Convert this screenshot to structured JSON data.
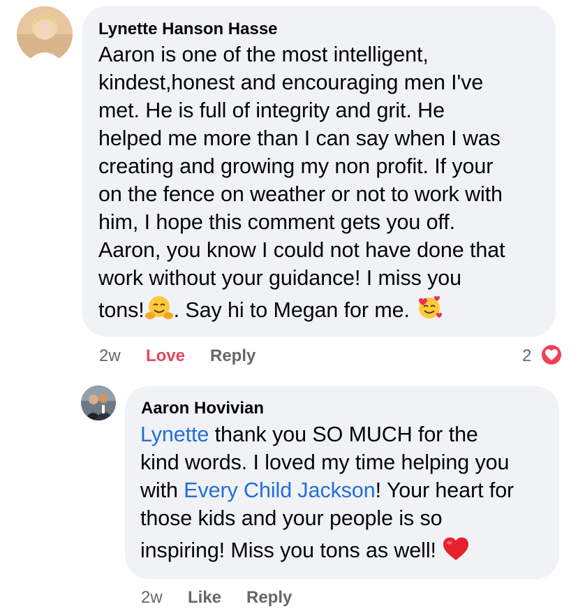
{
  "comment": {
    "author": "Lynette Hanson Hasse",
    "body_lines": [
      "Aaron is one of the most intelligent,",
      "kindest,honest and encouraging men I've",
      "met. He is full of integrity and grit. He",
      "helped me more than I can say when I was",
      "creating and growing my non profit. If your",
      "on the fence on weather or not to work with",
      "him, I hope this comment gets you off.",
      "Aaron, you know I could not have done that",
      "work without your guidance! I miss you"
    ],
    "last_line_a": "tons!",
    "last_line_b": ". Say hi to Megan for me.",
    "emoji_1": "hugging-face-emoji",
    "emoji_2": "smiling-face-with-hearts-emoji",
    "time": "2w",
    "love_label": "Love",
    "reply_label": "Reply",
    "reaction_count": "2",
    "reaction_icon": "heart-icon"
  },
  "reply": {
    "author": "Aaron Hovivian",
    "line1_mention": "Lynette",
    "line1_rest": " thank you SO MUCH for the",
    "line2": "kind words. I loved my time helping you",
    "line3_pre": "with ",
    "line3_mention": "Every Child Jackson",
    "line3_rest": "! Your heart for",
    "line4": "those kids and your people is so",
    "line5": "inspiring! Miss you tons as well!",
    "emoji": "red-heart-emoji",
    "time": "2w",
    "like_label": "Like",
    "reply_label": "Reply"
  },
  "colors": {
    "bubble": "#f0f2f5",
    "mention": "#216fdb",
    "love": "#e2465c",
    "meta": "#65676b",
    "heart_badge": "#f33e58"
  }
}
